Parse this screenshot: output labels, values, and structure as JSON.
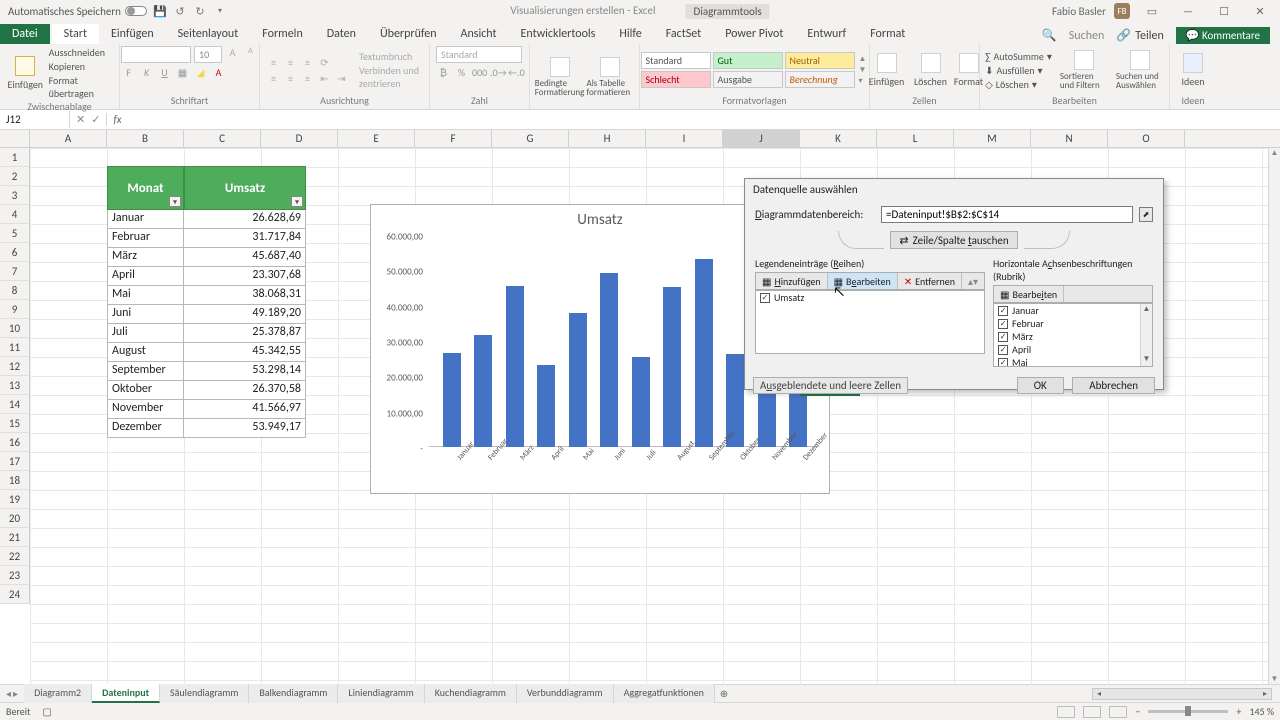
{
  "title_bar": {
    "autosave": "Automatisches Speichern",
    "doc": "Visualisierungen erstellen - Excel",
    "tool_context": "Diagrammtools",
    "user": "Fabio Basler",
    "user_initials": "FB"
  },
  "tabs": {
    "file": "Datei",
    "items": [
      "Start",
      "Einfügen",
      "Seitenlayout",
      "Formeln",
      "Daten",
      "Überprüfen",
      "Ansicht",
      "Entwicklertools",
      "Hilfe",
      "FactSet",
      "Power Pivot",
      "Entwurf",
      "Format"
    ],
    "active": "Start",
    "search_placeholder": "Suchen",
    "share": "Teilen",
    "comments": "Kommentare"
  },
  "ribbon": {
    "paste": "Einfügen",
    "cut": "Ausschneiden",
    "copy": "Kopieren",
    "painter": "Format übertragen",
    "g_clip": "Zwischenablage",
    "font_name": "",
    "font_size": "10",
    "g_font": "Schriftart",
    "wrap": "Textumbruch",
    "merge": "Verbinden und zentrieren",
    "g_align": "Ausrichtung",
    "numfmt": "Standard",
    "g_num": "Zahl",
    "condfmt": "Bedingte Formatierung",
    "astable": "Als Tabelle formatieren",
    "g_styles": "Formatvorlagen",
    "styles": {
      "standard": "Standard",
      "gut": "Gut",
      "neutral": "Neutral",
      "schlecht": "Schlecht",
      "ausgabe": "Ausgabe",
      "berech": "Berechnung"
    },
    "insert": "Einfügen",
    "delete": "Löschen",
    "format": "Format",
    "g_cells": "Zellen",
    "autosum": "AutoSumme",
    "fill": "Ausfüllen",
    "clear": "Löschen",
    "sort": "Sortieren und Filtern",
    "find": "Suchen und Auswählen",
    "g_edit": "Bearbeiten",
    "ideas": "Ideen"
  },
  "fx": {
    "cell_ref": "J12"
  },
  "columns": [
    "A",
    "B",
    "C",
    "D",
    "E",
    "F",
    "G",
    "H",
    "I",
    "J",
    "K",
    "L",
    "M",
    "N",
    "O"
  ],
  "row_count": 24,
  "table": {
    "header_month": "Monat",
    "header_value": "Umsatz",
    "rows": [
      {
        "m": "Januar",
        "v": "26.628,69"
      },
      {
        "m": "Februar",
        "v": "31.717,84"
      },
      {
        "m": "März",
        "v": "45.687,40"
      },
      {
        "m": "April",
        "v": "23.307,68"
      },
      {
        "m": "Mai",
        "v": "38.068,31"
      },
      {
        "m": "Juni",
        "v": "49.189,20"
      },
      {
        "m": "Juli",
        "v": "25.378,87"
      },
      {
        "m": "August",
        "v": "45.342,55"
      },
      {
        "m": "September",
        "v": "53.298,14"
      },
      {
        "m": "Oktober",
        "v": "26.370,58"
      },
      {
        "m": "November",
        "v": "41.566,97"
      },
      {
        "m": "Dezember",
        "v": "53.949,17"
      }
    ]
  },
  "chart_data": {
    "type": "bar",
    "title": "Umsatz",
    "categories": [
      "Januar",
      "Februar",
      "März",
      "April",
      "Mai",
      "Juni",
      "Juli",
      "August",
      "September",
      "Oktober",
      "November",
      "Dezember"
    ],
    "values": [
      26628.69,
      31717.84,
      45687.4,
      23307.68,
      38068.31,
      49189.2,
      25378.87,
      45342.55,
      53298.14,
      26370.58,
      41566.97,
      53949.17
    ],
    "ylabels": [
      "-",
      "10.000,00",
      "20.000,00",
      "30.000,00",
      "40.000,00",
      "50.000,00",
      "60.000,00"
    ],
    "ymax": 60000
  },
  "dialog": {
    "title": "Datenquelle auswählen",
    "range_label": "Diagrammdatenbereich:",
    "range_value": "=Dateninput!$B$2:$C$14",
    "swap": "Zeile/Spalte tauschen",
    "legend_caption": "Legendeneinträge (Reihen)",
    "axis_caption": "Horizontale Achsenbeschriftungen (Rubrik)",
    "add": "Hinzufügen",
    "edit": "Bearbeiten",
    "remove": "Entfernen",
    "series": [
      "Umsatz"
    ],
    "categories": [
      "Januar",
      "Februar",
      "März",
      "April",
      "Mai"
    ],
    "hidden_cells": "Ausgeblendete und leere Zellen",
    "ok": "OK",
    "cancel": "Abbrechen"
  },
  "sheets": {
    "items": [
      "Diagramm2",
      "Dateninput",
      "Säulendiagramm",
      "Balkendiagramm",
      "Liniendiagramm",
      "Kuchendiagramm",
      "Verbunddiagramm",
      "Aggregatfunktionen"
    ],
    "active": "Dateninput"
  },
  "status": {
    "ready": "Bereit",
    "zoom": "145 %"
  }
}
